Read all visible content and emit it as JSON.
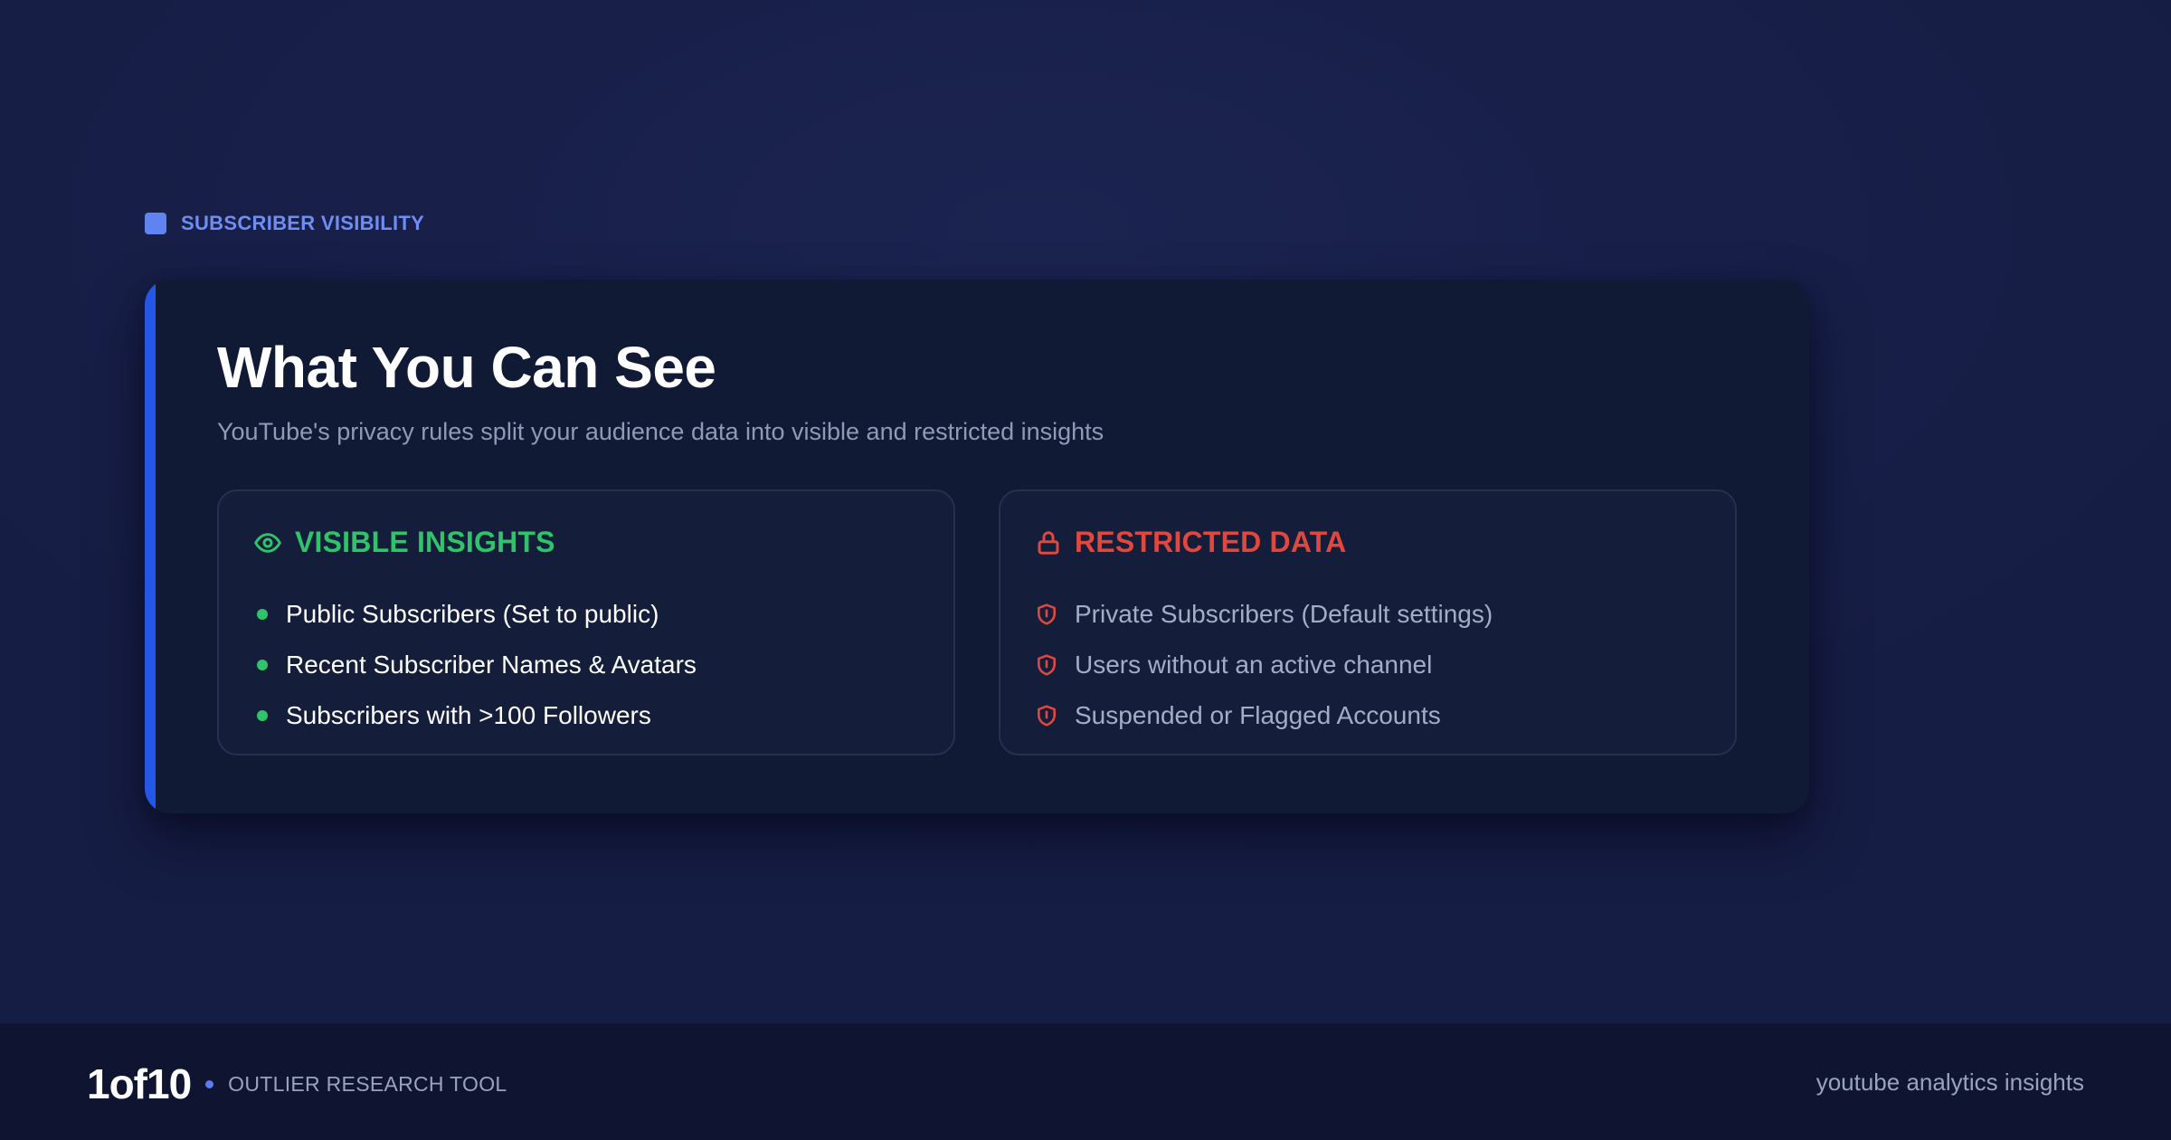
{
  "section": {
    "label": "SUBSCRIBER VISIBILITY"
  },
  "card": {
    "title": "What You Can See",
    "subtitle": "YouTube's privacy rules split your audience data into visible and restricted insights"
  },
  "visible_panel": {
    "title": "VISIBLE INSIGHTS",
    "icon": "eye-icon",
    "items": [
      "Public Subscribers (Set to public)",
      "Recent Subscriber Names & Avatars",
      "Subscribers with >100 Followers"
    ]
  },
  "restricted_panel": {
    "title": "RESTRICTED DATA",
    "icon": "lock-icon",
    "items": [
      "Private Subscribers (Default settings)",
      "Users without an active channel",
      "Suspended or Flagged Accounts"
    ]
  },
  "footer": {
    "brand": "1of10",
    "tagline": "OUTLIER RESEARCH TOOL",
    "right_text": "youtube analytics insights"
  },
  "colors": {
    "accent_blue": "#2456e8",
    "visible_green": "#2fc46a",
    "restricted_red": "#e0483e",
    "background": "#18204a"
  }
}
